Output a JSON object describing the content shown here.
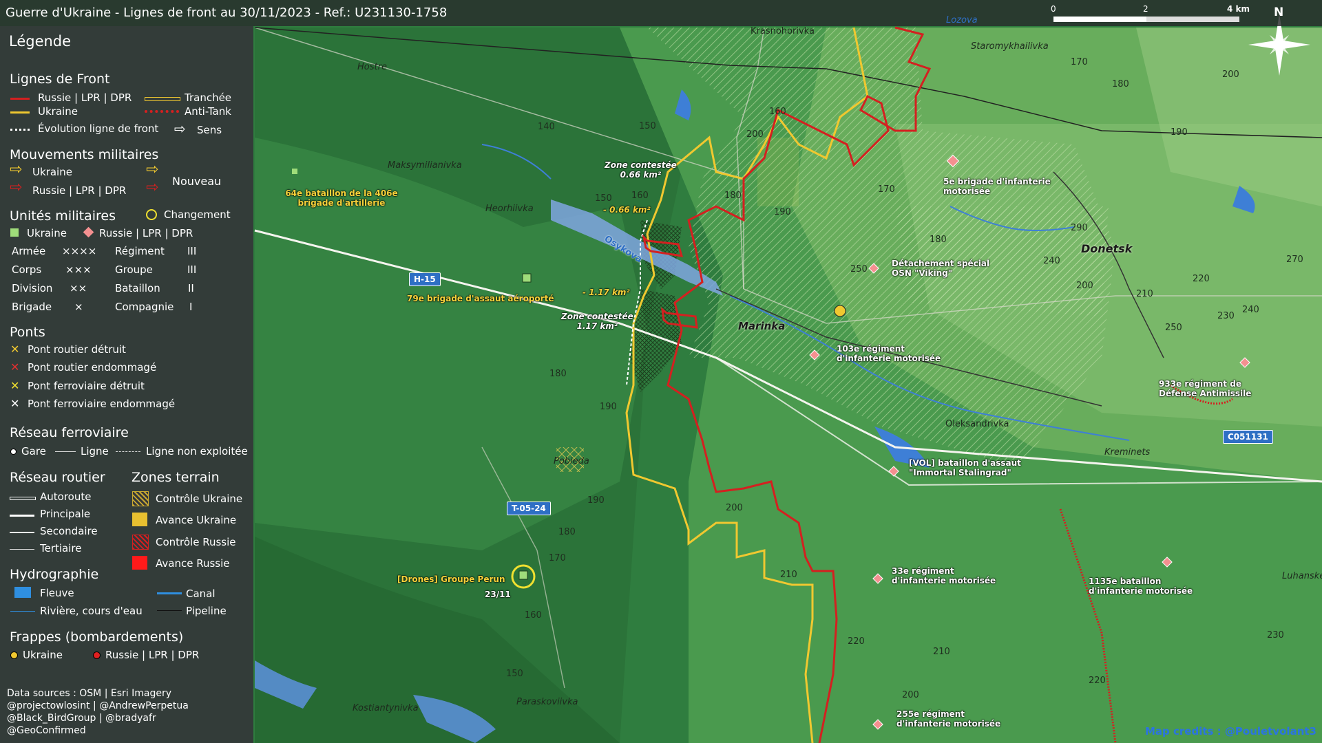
{
  "title": "Guerre d'Ukraine - Lignes de front au 30/11/2023 - Ref.: U231130-1758",
  "legend": {
    "heading": "Légende",
    "front": {
      "heading": "Lignes de Front",
      "russia": "Russie | LPR | DPR",
      "ukraine": "Ukraine",
      "evolution": "Évolution ligne de front",
      "trench": "Tranchée",
      "antitank": "Anti-Tank",
      "direction": "Sens"
    },
    "movements": {
      "heading": "Mouvements militaires",
      "ukraine": "Ukraine",
      "russia": "Russie | LPR | DPR",
      "new": "Nouveau"
    },
    "units": {
      "heading": "Unités militaires",
      "change": "Changement",
      "ukraine": "Ukraine",
      "russia": "Russie | LPR | DPR",
      "rows": [
        {
          "left": "Armée",
          "lsym": "××××",
          "right": "Régiment",
          "rsym": "III"
        },
        {
          "left": "Corps",
          "lsym": "×××",
          "right": "Groupe",
          "rsym": "III"
        },
        {
          "left": "Division",
          "lsym": "××",
          "right": "Bataillon",
          "rsym": "II"
        },
        {
          "left": "Brigade",
          "lsym": "×",
          "right": "Compagnie",
          "rsym": "I"
        }
      ]
    },
    "bridges": {
      "heading": "Ponts",
      "items": [
        "Pont routier détruit",
        "Pont routier endommagé",
        "Pont ferroviaire détruit",
        "Pont ferroviaire endommagé"
      ]
    },
    "rail": {
      "heading": "Réseau ferroviaire",
      "station": "Gare",
      "line": "Ligne",
      "unused": "Ligne non exploitée"
    },
    "roads": {
      "heading": "Réseau routier",
      "items": [
        "Autoroute",
        "Principale",
        "Secondaire",
        "Tertiaire"
      ]
    },
    "zones": {
      "heading": "Zones terrain",
      "items": [
        "Contrôle Ukraine",
        "Avance Ukraine",
        "Contrôle Russie",
        "Avance Russie"
      ]
    },
    "hydro": {
      "heading": "Hydrographie",
      "river_big": "Fleuve",
      "river": "Rivière, cours d'eau",
      "canal": "Canal",
      "pipeline": "Pipeline"
    },
    "strikes": {
      "heading": "Frappes (bombardements)",
      "ukraine": "Ukraine",
      "russia": "Russie | LPR | DPR"
    },
    "sources": [
      "Data sources : OSM | Esri Imagery",
      "@projectowlosint | @AndrewPerpetua",
      "@Black_BirdGroup | @bradyafr",
      "@GeoConfirmed"
    ]
  },
  "scale": {
    "t0": "0",
    "t2": "2",
    "t4": "4 km"
  },
  "north": "N",
  "credits": "Map credits : @Pouletvolant3",
  "places": [
    {
      "name": "Hostre"
    },
    {
      "name": "Krasnohorivka"
    },
    {
      "name": "Staromykhailivka"
    },
    {
      "name": "Maksymilianivka"
    },
    {
      "name": "Heorhiivka"
    },
    {
      "name": "Marinka"
    },
    {
      "name": "Donetsk"
    },
    {
      "name": "Oleksandrivka"
    },
    {
      "name": "Kreminets"
    },
    {
      "name": "Pobieda"
    },
    {
      "name": "Paraskoviivka"
    },
    {
      "name": "Kostiantynivka"
    },
    {
      "name": "Luhanske"
    },
    {
      "name": "Osykova"
    },
    {
      "name": "Lozova"
    }
  ],
  "roads": [
    "H-15",
    "T-05-24",
    "C051131"
  ],
  "contested": [
    {
      "label": "Zone contestée",
      "area": "0.66 km²"
    },
    {
      "label": "Zone contestée",
      "area": "1.17 km²"
    }
  ],
  "deltas": [
    "- 0.66 km²",
    "- 1.17 km²"
  ],
  "units": [
    {
      "name": "64e bataillon de la 406e brigade d'artillerie",
      "side": "ukraine"
    },
    {
      "name": "79e brigade d'assaut aéroporté",
      "side": "ukraine"
    },
    {
      "name": "[Drones] Groupe Perun",
      "side": "ukraine",
      "date": "23/11"
    },
    {
      "name": "5e brigade d'infanterie motorisée",
      "side": "russia"
    },
    {
      "name": "Détachement spécial OSN \"Viking\"",
      "side": "russia"
    },
    {
      "name": "103e régiment d'infanterie motorisée",
      "side": "russia"
    },
    {
      "name": "933e régiment de Défense Antimissile",
      "side": "russia"
    },
    {
      "name": "[VOL] bataillon d'assaut \"Immortal Stalingrad\"",
      "side": "russia"
    },
    {
      "name": "33e régiment d'infanterie motorisée",
      "side": "russia"
    },
    {
      "name": "1135e bataillon d'infanterie motorisée",
      "side": "russia"
    },
    {
      "name": "255e régiment d'infanterie motorisée",
      "side": "russia"
    }
  ],
  "contours": [
    "170",
    "180",
    "200",
    "160",
    "140",
    "150",
    "150",
    "160",
    "180",
    "190",
    "170",
    "180",
    "190",
    "290",
    "240",
    "250",
    "200",
    "270",
    "210",
    "220",
    "240",
    "230",
    "250",
    "180",
    "190",
    "200",
    "190",
    "180",
    "170",
    "160",
    "150",
    "200",
    "210",
    "220",
    "210",
    "220",
    "230",
    "200"
  ],
  "colors": {
    "russia": "#d42020",
    "ukraine": "#f0c830",
    "legend_bg": "#343739",
    "road_tag": "#2e6fc4"
  }
}
